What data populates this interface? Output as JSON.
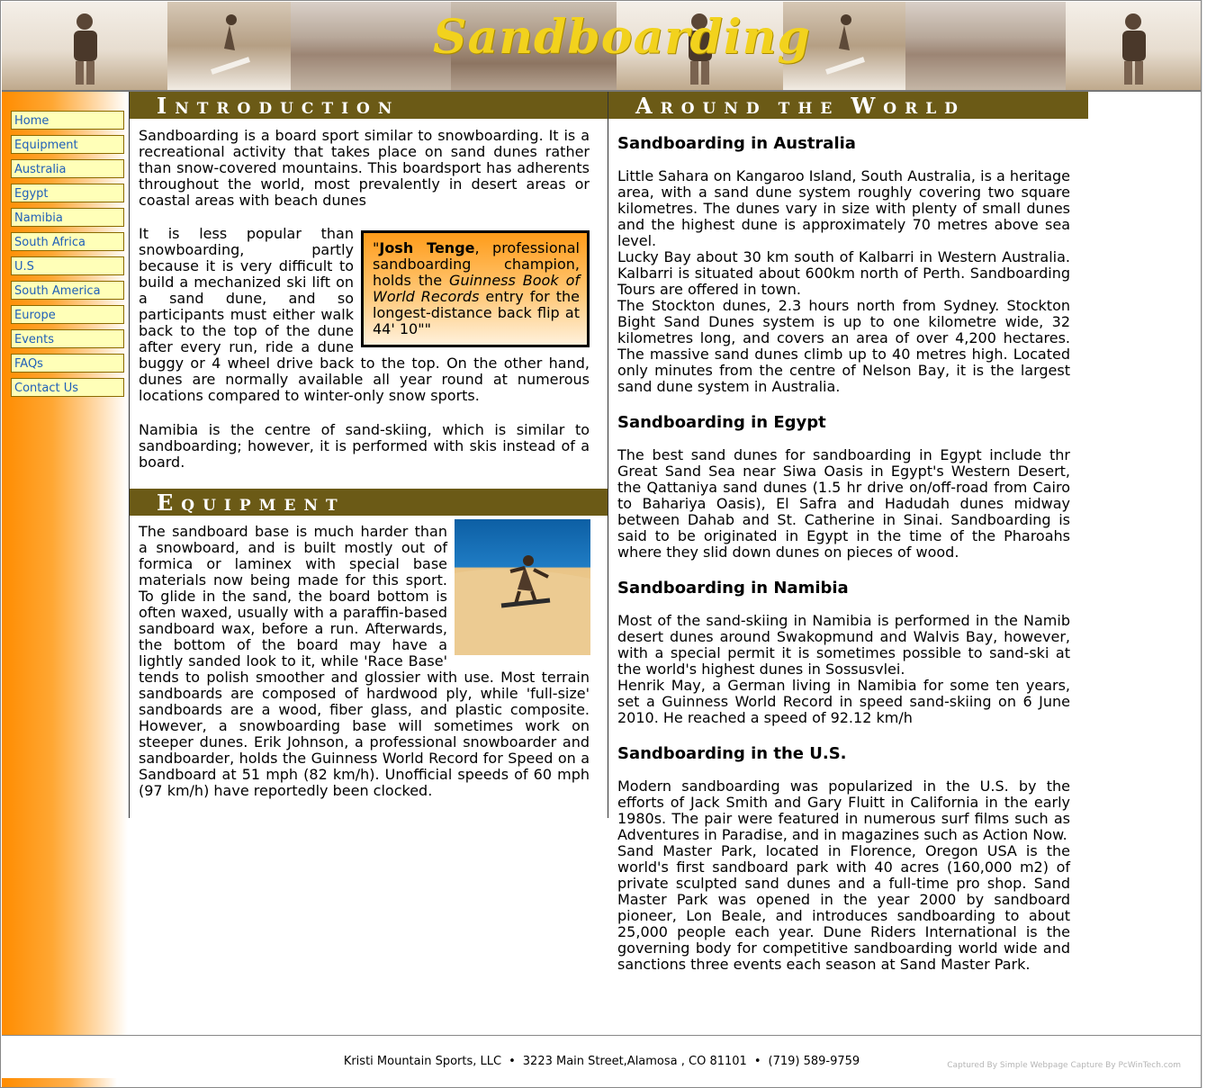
{
  "banner": {
    "title": "Sandboarding"
  },
  "nav": {
    "items": [
      {
        "label": "Home"
      },
      {
        "label": "Equipment"
      },
      {
        "label": "Australia"
      },
      {
        "label": "Egypt"
      },
      {
        "label": "Namibia"
      },
      {
        "label": "South Africa"
      },
      {
        "label": "U.S"
      },
      {
        "label": "South America"
      },
      {
        "label": "Europe"
      },
      {
        "label": "Events"
      },
      {
        "label": "FAQs"
      },
      {
        "label": "Contact Us"
      }
    ]
  },
  "intro": {
    "heading_initial": "I",
    "heading_rest": "NTRODUCTION",
    "p1": "Sandboarding is a board sport similar to snowboarding. It is a recreational activity that takes place on sand dunes rather than snow-covered mountains. This boardsport has adherents throughout the world, most prevalently in desert areas or coastal areas with beach dunes",
    "p2": "It is less popular than snowboarding, partly because it is very difficult to build a mechanized ski lift on a sand dune, and so participants must either walk back to the top of the dune after every run, ride a dune buggy or 4 wheel drive back to the top. On the other hand, dunes are normally available all year round at numerous locations compared to winter-only snow sports.",
    "quote": {
      "open": "\"",
      "name": "Josh Tenge",
      "mid": ", professional sandboarding champion, holds the ",
      "book": "Guinness Book of World Records",
      "end": " entry for the longest-distance back flip at 44' 10\"\""
    },
    "p3": "Namibia is the centre of sand-skiing, which is similar to sandboarding; however, it is performed with skis instead of a board."
  },
  "equipment": {
    "heading_initial": "E",
    "heading_rest": "QUIPMENT",
    "text": "The sandboard base is much harder than a snowboard, and is built mostly out of formica or laminex with special base materials now being made for this sport. To glide in the sand, the board bottom is often waxed, usually with a paraffin-based sandboard wax, before a run. Afterwards, the bottom of the board may have a lightly sanded look to it, while 'Race Base' tends to polish smoother and glossier with use. Most terrain sandboards are composed of hardwood ply, while 'full-size' sandboards are a wood, fiber glass, and plastic composite. However, a snowboarding base will sometimes work on steeper dunes. Erik Johnson, a professional snowboarder and sandboarder, holds the Guinness World Record for Speed on a Sandboard at 51 mph (82 km/h). Unofficial speeds of 60 mph (97 km/h) have reportedly been clocked."
  },
  "world": {
    "heading_initial1": "A",
    "heading_rest1": "ROUND",
    "heading_word2": "THE",
    "heading_initial3": "W",
    "heading_rest3": "ORLD",
    "sections": [
      {
        "title": "Sandboarding in Australia",
        "paras": [
          "Little Sahara on Kangaroo Island, South Australia, is a heritage area, with a sand dune system roughly covering two square kilometres. The dunes vary in size with plenty of small dunes and the highest dune is approximately 70 metres above sea level.",
          "Lucky Bay about 30 km south of Kalbarri in Western Australia. Kalbarri is situated about 600km north of Perth. Sandboarding Tours are offered in town.",
          "The Stockton dunes, 2.3 hours north from Sydney. Stockton Bight Sand Dunes system is up to one kilometre wide, 32 kilometres long, and covers an area of over 4,200 hectares. The massive sand dunes climb up to 40 metres high. Located only minutes from the centre of Nelson Bay, it is the largest sand dune system in Australia."
        ]
      },
      {
        "title": "Sandboarding in Egypt",
        "paras": [
          "The best sand dunes for sandboarding in Egypt include thr Great Sand Sea near Siwa Oasis in Egypt's Western Desert, the Qattaniya sand dunes (1.5 hr drive on/off-road from Cairo to Bahariya Oasis), El Safra and Hadudah dunes midway between Dahab and St. Catherine in Sinai. Sandboarding is said to be originated in Egypt in the time of the Pharoahs where they slid down dunes on pieces of wood."
        ]
      },
      {
        "title": "Sandboarding in Namibia",
        "paras": [
          "Most of the sand-skiing in Namibia is performed in the Namib desert dunes around Swakopmund and Walvis Bay, however, with a special permit it is sometimes possible to sand-ski at the world's highest dunes in Sossusvlei.",
          "Henrik May, a German living in Namibia for some ten years, set a Guinness World Record in speed sand-skiing on 6 June 2010. He reached a speed of 92.12 km/h"
        ]
      },
      {
        "title": "Sandboarding in the U.S.",
        "paras": [
          "Modern sandboarding was popularized in the U.S. by the efforts of Jack Smith and Gary Fluitt in California in the early 1980s. The pair were featured in numerous surf films such as Adventures in Paradise, and in magazines such as Action Now.",
          "Sand Master Park, located in Florence, Oregon USA is the world's first sandboard park with 40 acres (160,000 m2) of private sculpted sand dunes and a full-time pro shop. Sand Master Park was opened in the year 2000 by sandboard pioneer, Lon Beale, and introduces sandboarding to about 25,000 people each year. Dune Riders International is the governing body for competitive sandboarding world wide and sanctions three events each season at Sand Master Park."
        ]
      }
    ]
  },
  "footer": {
    "company": "Kristi Mountain Sports, LLC",
    "address": "3223 Main Street,Alamosa , CO 81101",
    "phone": "(719) 589-9759",
    "separator": "•",
    "capture": "Captured By Simple Webpage Capture By PcWinTech.com"
  }
}
